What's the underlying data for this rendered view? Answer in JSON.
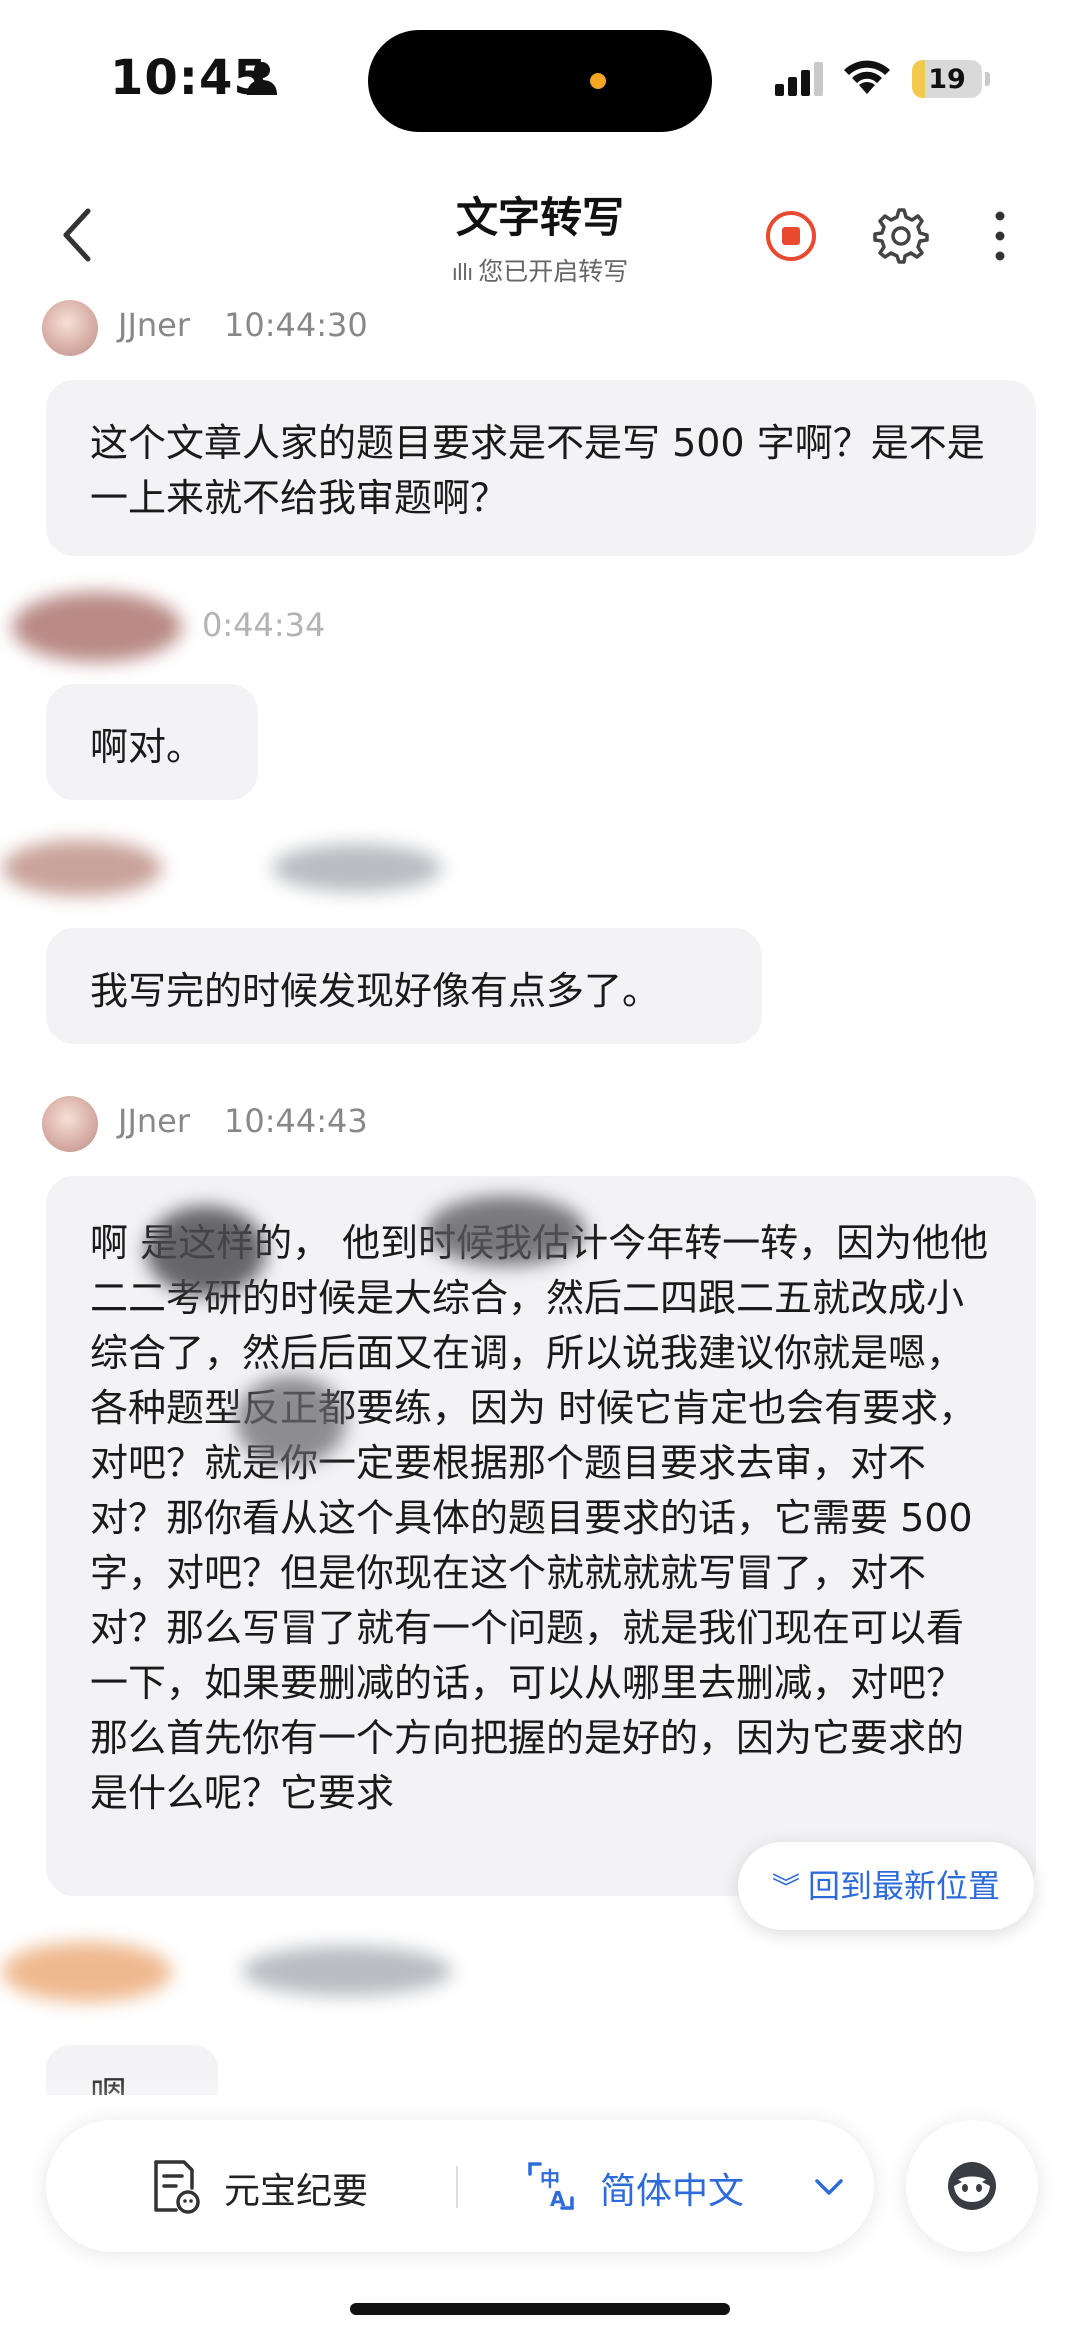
{
  "status_bar": {
    "time": "10:45",
    "battery": "19",
    "battery_level": 0.19,
    "icons": [
      "person-icon",
      "signal-icon",
      "wifi-icon",
      "battery-icon"
    ]
  },
  "header": {
    "title": "文字转写",
    "subtitle": "您已开启转写",
    "icons": [
      "back-icon",
      "record-stop-icon",
      "gear-icon",
      "more-icon"
    ],
    "accent": "#e8492f"
  },
  "transcript": {
    "entries": [
      {
        "speaker": "JJner",
        "time": "10:44:30",
        "text": "这个文章人家的题目要求是不是写 500 字啊？是不是一上来就不给我审题啊？"
      },
      {
        "speaker": "",
        "time": "0:44:34",
        "text": "啊对。"
      },
      {
        "speaker": "",
        "time": "",
        "text": "我写完的时候发现好像有点多了。"
      },
      {
        "speaker": "JJner",
        "time": "10:44:43",
        "text": "啊 是这样的， 他到时候我估计今年转一转，因为他他二二考研的时候是大综合，然后二四跟二五就改成小综合了，然后后面又在调，所以说我建议你就是嗯，各种题型反正都要练，因为 时候它肯定也会有要求，对吧？就是你一定要根据那个题目要求去审，对不对？那你看从这个具体的题目要求的话，它需要 500 字，对吧？但是你现在这个就就就就写冒了，对不对？那么写冒了就有一个问题，就是我们现在可以看一下，如果要删减的话，可以从哪里去删减，对吧？那么首先你有一个方向把握的是好的，因为它要求的是什么呢？它要求"
      },
      {
        "speaker": "",
        "time": "",
        "text": "嗯"
      }
    ],
    "scroll_latest_label": "回到最新位置"
  },
  "toolbar": {
    "summary_label": "元宝纪要",
    "language_label": "简体中文",
    "accent": "#2c6bd9"
  }
}
